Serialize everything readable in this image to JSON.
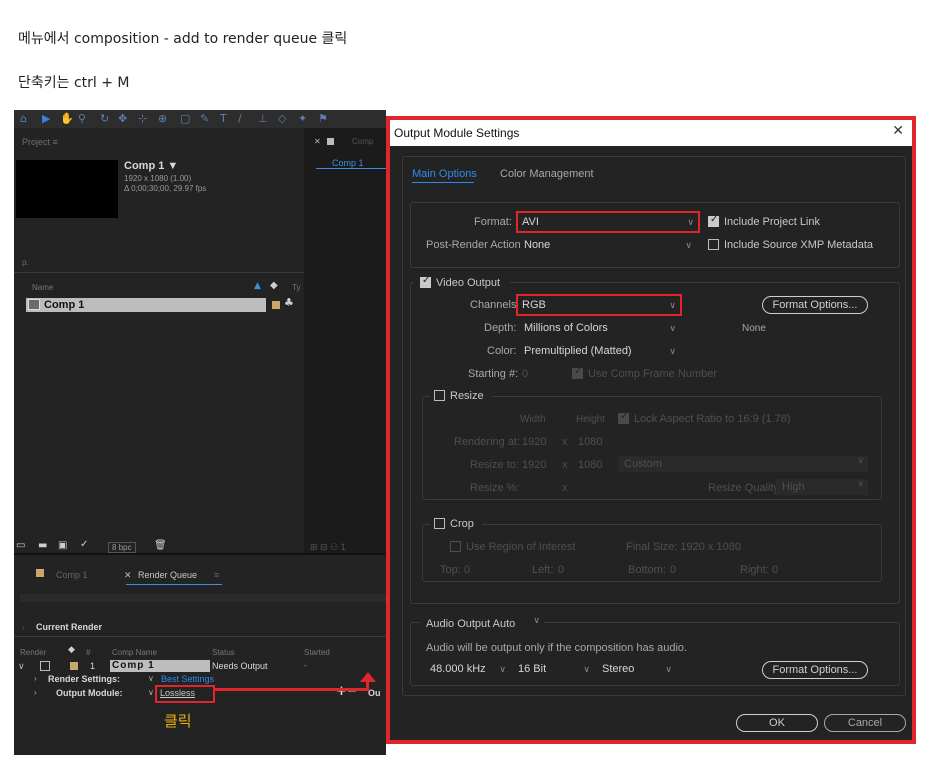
{
  "instructions": {
    "line1": "메뉴에서 composition - add to render queue 클릭",
    "line2": "단축키는 ctrl + M",
    "click_label": "클릭"
  },
  "project_panel": {
    "tab": "Project  ≡",
    "comp_name": "Comp 1 ▼",
    "comp_res": "1920 x 1080 (1.00)",
    "comp_dur": "Δ 0;00;30;00, 29.97 fps",
    "search_placeholder": "ρ.",
    "col_name": "Name",
    "col_type": "Ty",
    "item_name": "Comp 1",
    "bpc": "8 bpc"
  },
  "comp_viewer": {
    "tab": "Comp",
    "inner_tab": "Comp 1"
  },
  "render_queue": {
    "tab_comp": "Comp 1",
    "tab_rq": "Render Queue",
    "tab_rq_menu": "≡",
    "current_render": "Current Render",
    "col_render": "Render",
    "col_num": "#",
    "col_compname": "Comp Name",
    "col_status": "Status",
    "col_started": "Started",
    "row_num": "1",
    "row_comp": "Comp 1",
    "row_status": "Needs Output",
    "row_started": "-",
    "render_settings_label": "Render Settings:",
    "render_settings_value": "Best Settings",
    "output_module_label": "Output Module:",
    "output_module_value": "Lossless",
    "output_to_label": "Ou"
  },
  "dialog": {
    "title": "Output Module Settings",
    "close": "✕",
    "tabs": [
      "Main Options",
      "Color Management"
    ],
    "format_label": "Format:",
    "format_value": "AVI",
    "include_project_link": "Include Project Link",
    "post_render_label": "Post-Render Action:",
    "post_render_value": "None",
    "include_xmp": "Include Source XMP Metadata",
    "video_output": "Video Output",
    "channels_label": "Channels:",
    "channels_value": "RGB",
    "format_options": "Format Options...",
    "depth_label": "Depth:",
    "depth_value": "Millions of Colors",
    "codec_none": "None",
    "color_label": "Color:",
    "color_value": "Premultiplied (Matted)",
    "starting_label": "Starting #:",
    "starting_value": "0",
    "use_comp_frame": "Use Comp Frame Number",
    "resize": "Resize",
    "width_label": "Width",
    "height_label": "Height",
    "lock_aspect": "Lock Aspect Ratio to 16:9 (1.78)",
    "rendering_at_label": "Rendering at:",
    "rendering_at_w": "1920",
    "rendering_at_h": "1080",
    "resize_to_label": "Resize to:",
    "resize_to_w": "1920",
    "resize_to_h": "1080",
    "resize_preset": "Custom",
    "resize_pct_label": "Resize %:",
    "times": "x",
    "resize_quality_label": "Resize Quality:",
    "resize_quality_value": "High",
    "crop": "Crop",
    "use_roi": "Use Region of Interest",
    "final_size": "Final Size: 1920 x 1080",
    "top_label": "Top:",
    "top_value": "0",
    "left_label": "Left:",
    "left_value": "0",
    "bottom_label": "Bottom:",
    "bottom_value": "0",
    "right_label": "Right:",
    "right_value": "0",
    "audio_output": "Audio Output Auto",
    "audio_note": "Audio will be output only if the composition has audio.",
    "sample_rate": "48.000 kHz",
    "bit_depth": "16 Bit",
    "channels_audio": "Stereo",
    "audio_format_options": "Format Options...",
    "ok": "OK",
    "cancel": "Cancel"
  },
  "colors": {
    "highlight_red": "#e0262c",
    "panel_bg": "#232323",
    "link_blue": "#2d8ceb",
    "label_yellow": "#e8b10a"
  }
}
